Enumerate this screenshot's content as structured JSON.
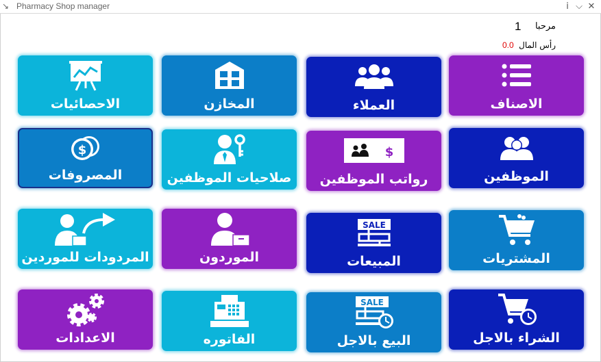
{
  "window": {
    "title": "Pharmacy Shop manager",
    "controls": {
      "info": "i",
      "minimize": "⌵",
      "close": "✕"
    }
  },
  "header": {
    "welcome_label": "مرحبا",
    "user_id": "1",
    "capital_label": "رأس المال",
    "capital_value": "0.0",
    "capital_color": "#e00000"
  },
  "tiles": [
    {
      "label": "الاحصائيات",
      "icon": "statistics-board-icon",
      "color": "#0cb4da"
    },
    {
      "label": "المخازن",
      "icon": "warehouse-icon",
      "color": "#0c7ec8"
    },
    {
      "label": "العملاء",
      "icon": "customers-group-icon",
      "color": "#0a1fb8"
    },
    {
      "label": "الاصناف",
      "icon": "list-icon",
      "color": "#8f22c2"
    },
    {
      "label": "المصروفات",
      "icon": "coins-icon",
      "color": "#0c7ec8"
    },
    {
      "label": "صلاحيات الموظفين",
      "icon": "employee-key-icon",
      "color": "#0cb4da"
    },
    {
      "label": "رواتب الموظفين",
      "icon": "salary-icon",
      "color": "#8f22c2"
    },
    {
      "label": "الموظفين",
      "icon": "employees-icon",
      "color": "#0a1fb8"
    },
    {
      "label": "المردودات للموردين",
      "icon": "supplier-return-icon",
      "color": "#0cb4da"
    },
    {
      "label": "الموردون",
      "icon": "supplier-icon",
      "color": "#8f22c2"
    },
    {
      "label": "المبيعات",
      "icon": "sale-sign-icon",
      "color": "#0a1fb8"
    },
    {
      "label": "المشتريات",
      "icon": "shopping-cart-icon",
      "color": "#0c7ec8"
    },
    {
      "label": "الاعدادات",
      "icon": "gears-icon",
      "color": "#8f22c2"
    },
    {
      "label": "الفاتوره",
      "icon": "cash-register-icon",
      "color": "#0cb4da"
    },
    {
      "label": "البيع بالاجل",
      "icon": "sale-clock-icon",
      "color": "#0c7ec8"
    },
    {
      "label": "الشراء بالاجل",
      "icon": "cart-clock-icon",
      "color": "#0a1fb8"
    }
  ]
}
